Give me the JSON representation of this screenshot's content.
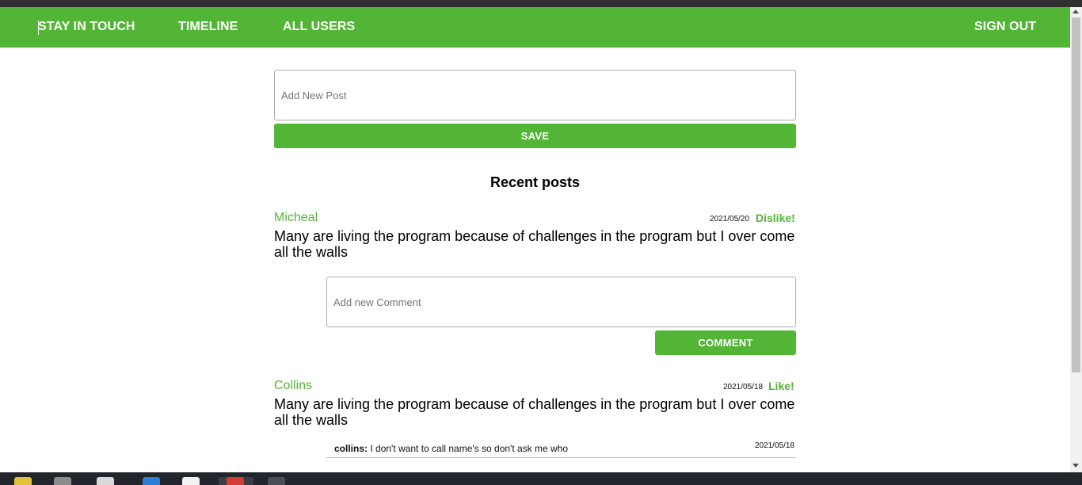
{
  "nav": {
    "brand": "STAY IN TOUCH",
    "timeline": "TIMELINE",
    "all_users": "ALL USERS",
    "sign_out": "SIGN OUT"
  },
  "new_post": {
    "placeholder": "Add New Post",
    "save_label": "SAVE"
  },
  "section_title": "Recent posts",
  "posts": [
    {
      "author": "Micheal",
      "date": "2021/05/20",
      "reaction": "Dislike!",
      "text": "Many are living the program because of challenges in the program but I over come all the walls",
      "comment_placeholder": "Add new Comment",
      "comment_button": "COMMENT"
    },
    {
      "author": "Collins",
      "date": "2021/05/18",
      "reaction": "Like!",
      "text": "Many are living the program because of challenges in the program but I over come all the walls",
      "comments": [
        {
          "author": "collins:",
          "text": "I don't want to call name's so don't ask me who",
          "date": "2021/05/18"
        }
      ]
    }
  ],
  "colors": {
    "accent": "#52b535",
    "nav_text": "#ffffff",
    "taskbar": "#22252b"
  }
}
